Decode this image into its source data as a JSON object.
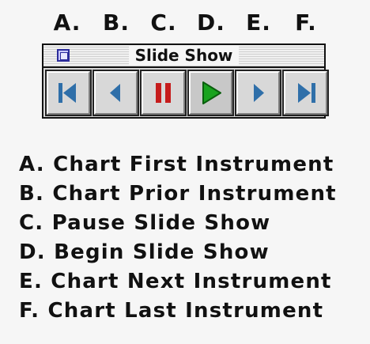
{
  "letters": [
    "A.",
    "B.",
    "C.",
    "D.",
    "E.",
    "F."
  ],
  "palette": {
    "title": "Slide Show",
    "buttons": [
      {
        "id": "first",
        "icon": "skip-first-icon",
        "color": "#2f6fa9"
      },
      {
        "id": "prior",
        "icon": "step-back-icon",
        "color": "#2f6fa9"
      },
      {
        "id": "pause",
        "icon": "pause-icon",
        "color": "#c61c1c"
      },
      {
        "id": "begin",
        "icon": "play-icon",
        "color": "#19a31e"
      },
      {
        "id": "next",
        "icon": "step-forward-icon",
        "color": "#2f6fa9"
      },
      {
        "id": "last",
        "icon": "skip-last-icon",
        "color": "#2f6fa9"
      }
    ]
  },
  "legend": [
    "A. Chart First Instrument",
    "B. Chart Prior Instrument",
    "C. Pause Slide Show",
    "D. Begin Slide Show",
    "E. Chart Next Instrument",
    "F. Chart Last Instrument"
  ]
}
